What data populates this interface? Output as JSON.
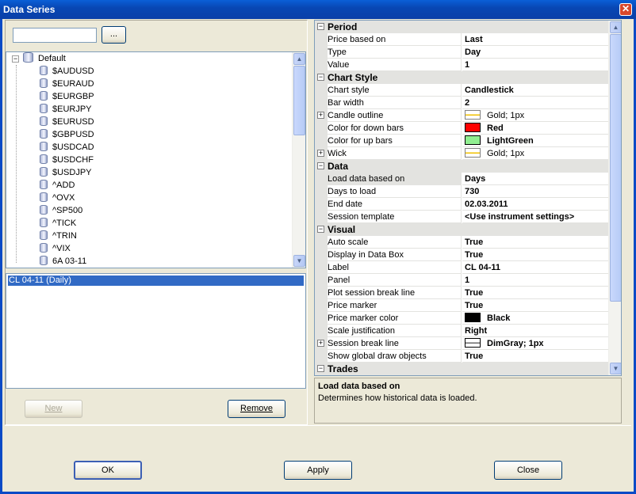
{
  "window": {
    "title": "Data Series",
    "close_glyph": "✕"
  },
  "search": {
    "value": "",
    "browse_label": "..."
  },
  "instruments": {
    "root": "Default",
    "items": [
      "$AUDUSD",
      "$EURAUD",
      "$EURGBP",
      "$EURJPY",
      "$EURUSD",
      "$GBPUSD",
      "$USDCAD",
      "$USDCHF",
      "$USDJPY",
      "^ADD",
      "^OVX",
      "^SP500",
      "^TICK",
      "^TRIN",
      "^VIX",
      "6A 03-11"
    ]
  },
  "series": {
    "selected": "CL 04-11 (Daily)"
  },
  "buttons": {
    "new": "New",
    "remove": "Remove",
    "ok": "OK",
    "apply": "Apply",
    "close": "Close"
  },
  "properties": {
    "period": {
      "label": "Period",
      "rows": [
        {
          "name": "Price based on",
          "value": "Last"
        },
        {
          "name": "Type",
          "value": "Day"
        },
        {
          "name": "Value",
          "value": "1"
        }
      ]
    },
    "chart_style": {
      "label": "Chart Style",
      "rows": [
        {
          "name": "Chart style",
          "value": "Candlestick"
        },
        {
          "name": "Bar width",
          "value": "2"
        },
        {
          "name": "Candle outline",
          "value": "Gold; 1px"
        },
        {
          "name": "Color for down bars",
          "value": "Red"
        },
        {
          "name": "Color for up bars",
          "value": "LightGreen"
        },
        {
          "name": "Wick",
          "value": "Gold; 1px"
        }
      ]
    },
    "data": {
      "label": "Data",
      "rows": [
        {
          "name": "Load data based on",
          "value": "Days"
        },
        {
          "name": "Days to load",
          "value": "730"
        },
        {
          "name": "End date",
          "value": "02.03.2011"
        },
        {
          "name": "Session template",
          "value": "<Use instrument settings>"
        }
      ]
    },
    "visual": {
      "label": "Visual",
      "rows": [
        {
          "name": "Auto scale",
          "value": "True"
        },
        {
          "name": "Display in Data Box",
          "value": "True"
        },
        {
          "name": "Label",
          "value": "CL 04-11"
        },
        {
          "name": "Panel",
          "value": "1"
        },
        {
          "name": "Plot session break line",
          "value": "True"
        },
        {
          "name": "Price marker",
          "value": "True"
        },
        {
          "name": "Price marker color",
          "value": "Black"
        },
        {
          "name": "Scale justification",
          "value": "Right"
        },
        {
          "name": "Session break line",
          "value": "DimGray; 1px"
        },
        {
          "name": "Show global draw objects",
          "value": "True"
        }
      ]
    },
    "trades": {
      "label": "Trades"
    }
  },
  "colors": {
    "gold": "#f0c000",
    "red": "#ff0000",
    "light_green": "#90ee90",
    "black": "#000000",
    "dim_gray": "#696969",
    "selection": "#316ac5"
  },
  "description": {
    "title": "Load data based on",
    "text": "Determines how historical data is loaded."
  }
}
